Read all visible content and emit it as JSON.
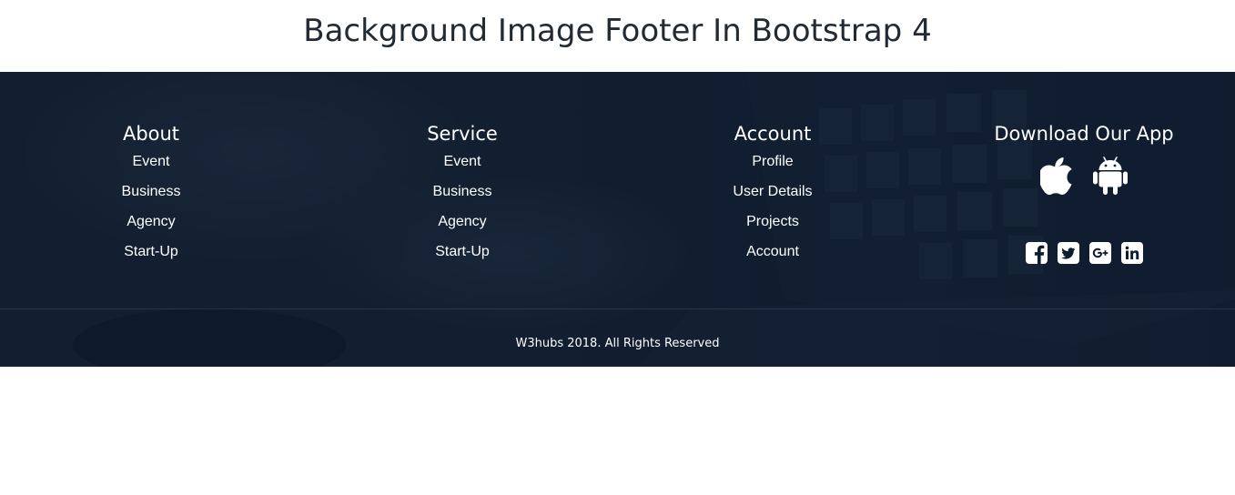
{
  "page": {
    "title": "Background Image Footer In Bootstrap 4"
  },
  "footer": {
    "columns": [
      {
        "heading": "About",
        "links": [
          "Event",
          "Business",
          "Agency",
          "Start-Up"
        ]
      },
      {
        "heading": "Service",
        "links": [
          "Event",
          "Business",
          "Agency",
          "Start-Up"
        ]
      },
      {
        "heading": "Account",
        "links": [
          "Profile",
          "User Details",
          "Projects",
          "Account"
        ]
      }
    ],
    "app": {
      "heading": "Download Our App",
      "store_icons": [
        "apple-icon",
        "android-icon"
      ],
      "social_icons": [
        "facebook-icon",
        "twitter-icon",
        "google-plus-icon",
        "linkedin-icon"
      ]
    },
    "copyright": "W3hubs 2018. All Rights Reserved"
  },
  "colors": {
    "footer_background": "#0f1b2e",
    "text": "#ffffff",
    "page_title": "#222a33"
  }
}
